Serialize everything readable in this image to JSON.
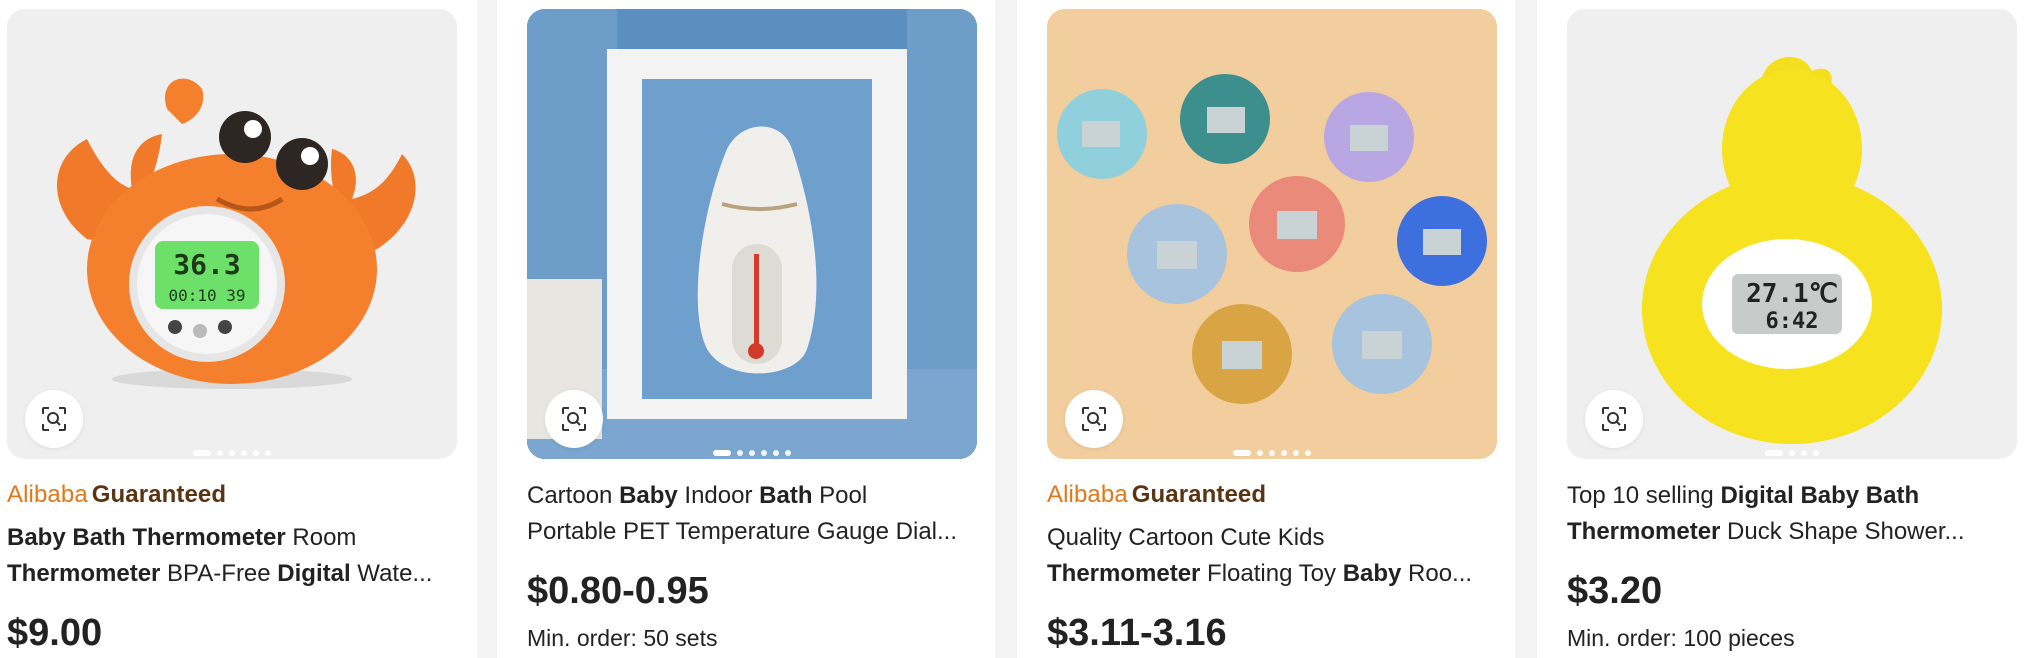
{
  "products": [
    {
      "badge": {
        "part1": "Alibaba",
        "part2": "Guaranteed"
      },
      "title_segments": [
        {
          "text": "Baby Bath Thermometer",
          "bold": true
        },
        {
          "text": " Room ",
          "bold": false
        },
        {
          "text": "Thermometer",
          "bold": true
        },
        {
          "text": " BPA-Free ",
          "bold": false
        },
        {
          "text": "Digital",
          "bold": true
        },
        {
          "text": " Wate...",
          "bold": false
        }
      ],
      "price": "$9.00",
      "min_order": "",
      "image": "orange crab bath thermometer",
      "display_reading": {
        "temp": "36.3",
        "time": "00:10 39"
      }
    },
    {
      "badge": null,
      "title_segments": [
        {
          "text": "Cartoon ",
          "bold": false
        },
        {
          "text": "Baby",
          "bold": true
        },
        {
          "text": " Indoor ",
          "bold": false
        },
        {
          "text": "Bath",
          "bold": true
        },
        {
          "text": " Pool",
          "bold": false
        },
        {
          "text": "Portable PET Temperature Gauge Dial...",
          "bold": false
        }
      ],
      "price": "$0.80-0.95",
      "min_order": "Min. order: 50 sets",
      "image": "white seal thermometer in frame"
    },
    {
      "badge": {
        "part1": "Alibaba",
        "part2": "Guaranteed"
      },
      "title_segments": [
        {
          "text": "Quality Cartoon Cute Kids",
          "bold": false
        },
        {
          "text": "Thermometer",
          "bold": true
        },
        {
          "text": " Floating Toy ",
          "bold": false
        },
        {
          "text": "Baby",
          "bold": true
        },
        {
          "text": " Roo...",
          "bold": false
        }
      ],
      "price": "$3.11-3.16",
      "min_order": "",
      "image": "assorted animal thermometers"
    },
    {
      "badge": null,
      "title_segments": [
        {
          "text": "Top 10 selling ",
          "bold": false
        },
        {
          "text": "Digital Baby Bath",
          "bold": true
        },
        {
          "text": "Thermometer",
          "bold": true
        },
        {
          "text": " Duck Shape Shower...",
          "bold": false
        }
      ],
      "price": "$3.20",
      "min_order": "Min. order: 100 pieces",
      "image": "yellow duck thermometer",
      "display_reading": {
        "temp": "27.1℃",
        "time": "6:42"
      }
    }
  ],
  "icons": {
    "image_search": "image-search-icon"
  }
}
